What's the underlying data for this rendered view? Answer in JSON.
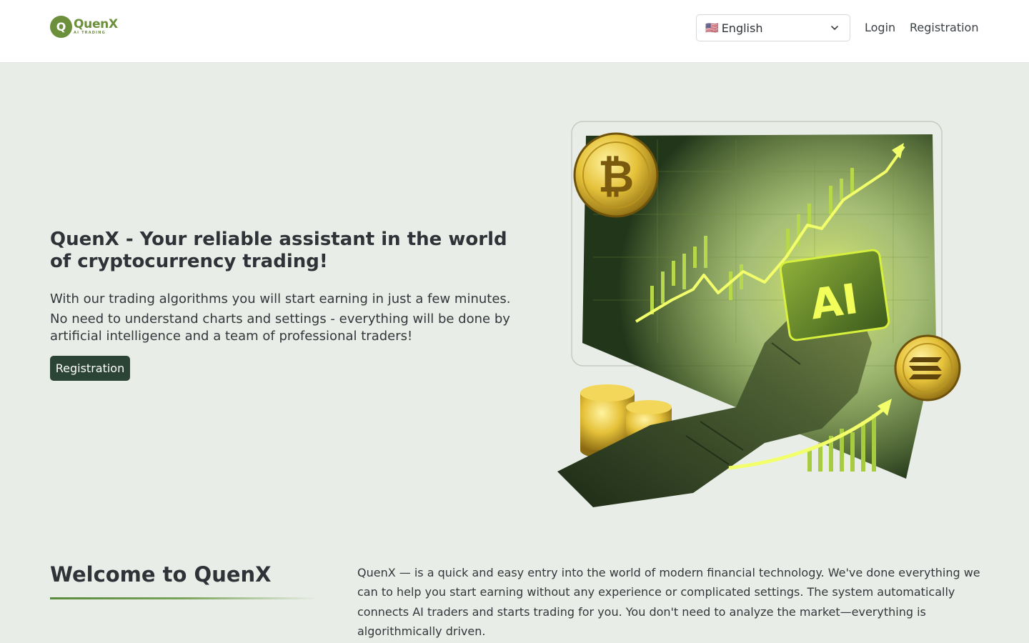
{
  "header": {
    "logo": {
      "letter": "Q",
      "name": "QuenX",
      "tagline": "AI TRADING"
    },
    "language": {
      "flag": "🇺🇸",
      "selected": "English"
    },
    "nav": {
      "login": "Login",
      "registration": "Registration"
    }
  },
  "hero": {
    "title": "QuenX - Your reliable assistant in the world of cryptocurrency trading!",
    "paragraph1": "With our trading algorithms you will start earning in just a few minutes.",
    "paragraph2": "No need to understand charts and settings - everything will be done by artificial intelligence and a team of professional traders!",
    "button": "Registration",
    "image": {
      "chip_text": "AI",
      "coin_symbol": "₿"
    }
  },
  "welcome": {
    "title": "Welcome to QuenX",
    "text": "QuenX — is a quick and easy entry into the world of modern financial technology. We've done everything we can to help you start earning without any experience or complicated settings. The system automatically connects AI traders and starts trading for you. You don't need to analyze the market—everything is algorithmically driven."
  },
  "colors": {
    "brand_green": "#6b8f3a",
    "button_dark": "#2b4436",
    "page_bg": "#e9ede7",
    "gold": "#e6c23a",
    "neon": "#d6f03c"
  }
}
